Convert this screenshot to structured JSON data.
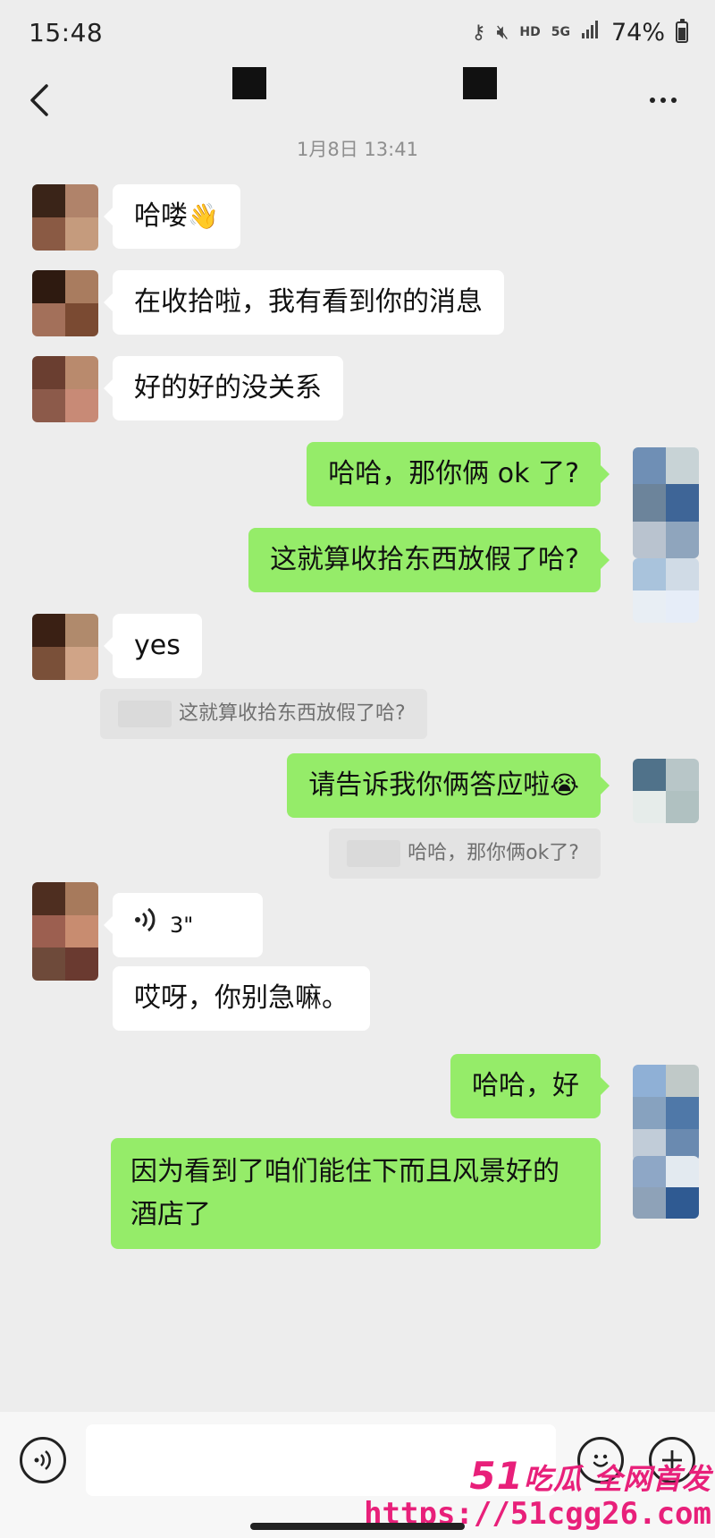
{
  "status_bar": {
    "time": "15:48",
    "hd_label": "HD",
    "net_label": "5G",
    "battery": "74%"
  },
  "nav": {
    "back_icon": "chevron-left-icon",
    "more_icon": "more-dots-icon"
  },
  "timestamp": "1月8日 13:41",
  "messages": [
    {
      "dir": "in",
      "text": "哈喽",
      "emoji": "👋"
    },
    {
      "dir": "in",
      "text": "在收拾啦，我有看到你的消息"
    },
    {
      "dir": "in",
      "text": "好的好的没关系"
    },
    {
      "dir": "out",
      "text": "哈哈，那你俩 ok 了?"
    },
    {
      "dir": "out",
      "text": "这就算收拾东西放假了哈?"
    },
    {
      "dir": "in",
      "text": "yes"
    },
    {
      "dir": "quote",
      "text": "这就算收拾东西放假了哈?"
    },
    {
      "dir": "out",
      "text": "请告诉我你俩答应啦",
      "emoji": "😭"
    },
    {
      "dir": "quote",
      "text": "哈哈，那你俩ok了?"
    },
    {
      "dir": "in",
      "type": "voice",
      "duration": "3\""
    },
    {
      "dir": "in",
      "text": "哎呀，你别急嘛。"
    },
    {
      "dir": "out",
      "text": "哈哈，好"
    },
    {
      "dir": "out",
      "text_line1": "因为看到了咱们能住下而且风景好的",
      "text_line2": "酒店了"
    }
  ],
  "input_bar": {
    "voice_icon": "voice-input-icon",
    "emoji_icon": "emoji-icon",
    "plus_icon": "plus-icon"
  },
  "watermark": {
    "num": "51",
    "line1": "吃瓜 全网首发",
    "line2": "https://51cgg26.com"
  },
  "colors": {
    "background": "#ededed",
    "out_bubble": "#95ec69",
    "in_bubble": "#ffffff",
    "watermark": "#e8207a"
  }
}
